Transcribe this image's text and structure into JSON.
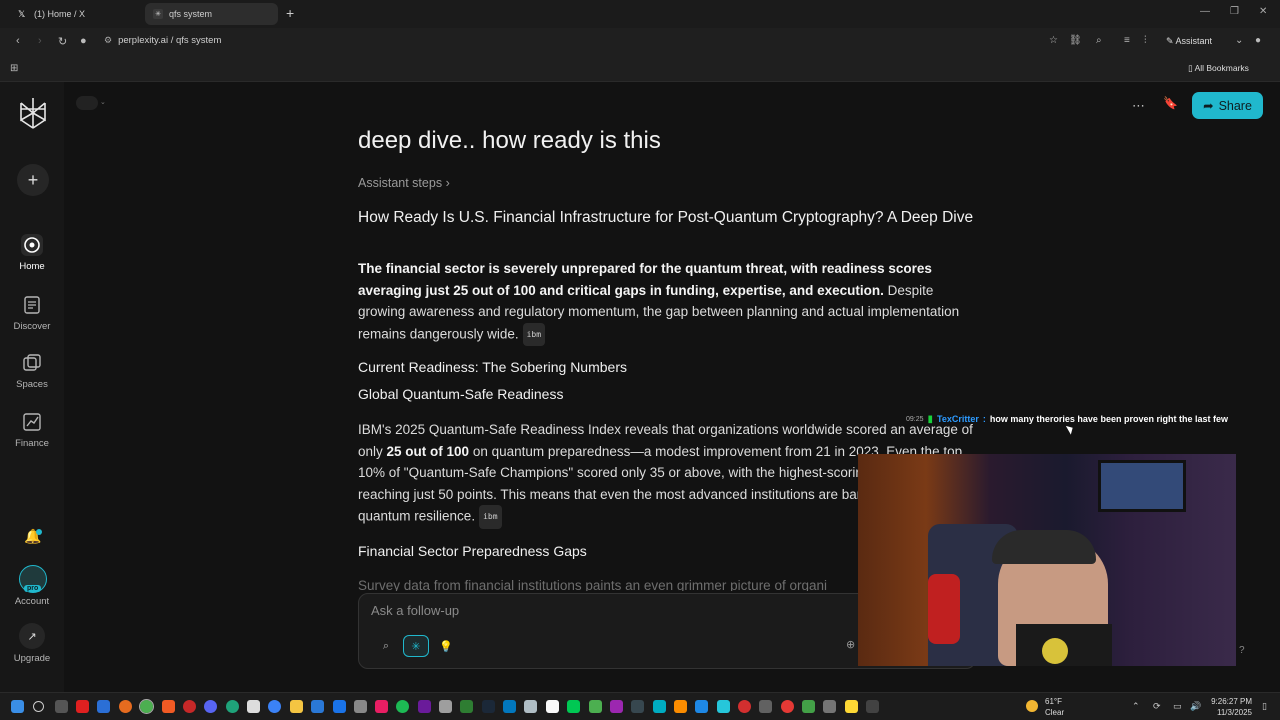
{
  "browser": {
    "tabs": [
      {
        "label": "(1) Home / X",
        "icon": "x-icon"
      },
      {
        "label": "qfs system",
        "icon": "perplexity-icon"
      }
    ],
    "url": "perplexity.ai / qfs system",
    "assistant_label": "Assistant",
    "bookmarks_label": "All Bookmarks"
  },
  "sidebar": {
    "items": [
      {
        "label": "Home",
        "icon": "home-icon"
      },
      {
        "label": "Discover",
        "icon": "discover-icon"
      },
      {
        "label": "Spaces",
        "icon": "spaces-icon"
      },
      {
        "label": "Finance",
        "icon": "finance-icon"
      }
    ],
    "account_label": "Account",
    "pro_badge": "pro",
    "upgrade_label": "Upgrade"
  },
  "header": {
    "share_label": "Share"
  },
  "thread": {
    "question": "deep dive.. how ready is this",
    "assistant_steps": "Assistant steps",
    "answer_title": "How Ready Is U.S. Financial Infrastructure for Post-Quantum Cryptography? A Deep Dive",
    "intro_bold": "The financial sector is severely unprepared for the quantum threat, with readiness scores averaging just 25 out of 100 and critical gaps in funding, expertise, and execution.",
    "intro_rest": " Despite growing awareness and regulatory momentum, the gap between planning and actual implementation remains dangerously wide.",
    "citation": "ibm",
    "section1": "Current Readiness: The Sobering Numbers",
    "subsection1": "Global Quantum-Safe Readiness",
    "para2_a": "IBM's 2025 Quantum-Safe Readiness Index reveals that organizations worldwide scored an average of only ",
    "para2_bold": "25 out of 100",
    "para2_b": " on quantum preparedness—a modest improvement from 21 in 2023. Even the top 10% of \"Quantum-Safe Champions\" scored only 35 or above, with the highest-scoring organization reaching just 50 points. This means that even the most advanced institutions are barely halfway to true quantum resilience.",
    "section2": "Financial Sector Preparedness Gaps",
    "para3": "Survey data from financial institutions paints an even grimmer picture of organi"
  },
  "followup": {
    "placeholder": "Ask a follow-up"
  },
  "chat_overlay": {
    "time": "09:25",
    "user": "TexCritter",
    "message": "how many therories have been proven right the last few"
  },
  "taskbar": {
    "temperature": "61°F",
    "condition": "Clear",
    "time": "9:26:27 PM",
    "date": "11/3/2025"
  },
  "colors": {
    "accent": "#20b8cd",
    "background": "#121212"
  }
}
